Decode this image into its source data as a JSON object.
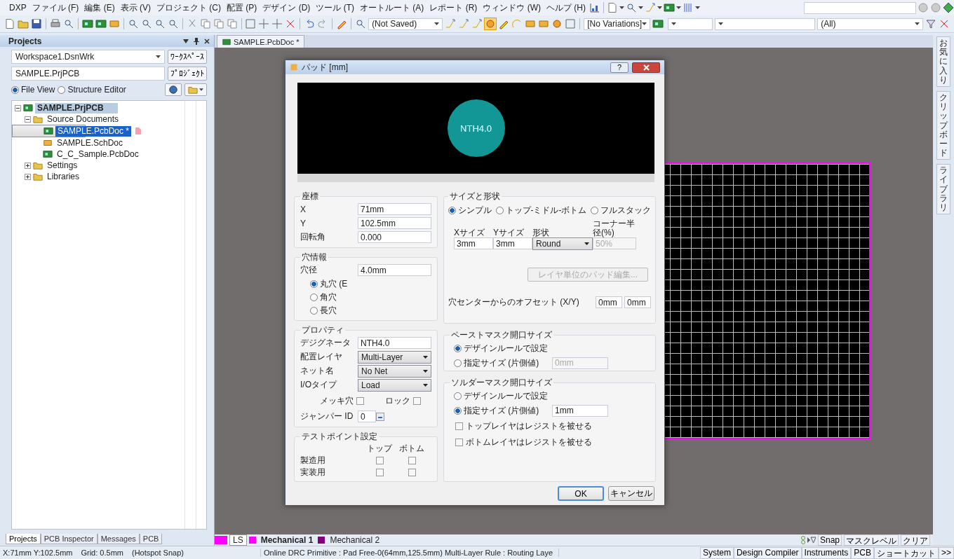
{
  "menu_bar": {
    "items": [
      "DXP",
      "ファイル (F)",
      "編集 (E)",
      "表示 (V)",
      "プロジェクト (C)",
      "配置 (P)",
      "デザイン (D)",
      "ツール (T)",
      "オートルート (A)",
      "レポート (R)",
      "ウィンドウ (W)",
      "ヘルプ (H)"
    ]
  },
  "toolbar": {
    "document_combo": "(Not Saved)",
    "variations_combo": "[No Variations]",
    "filter_combo": "(All)"
  },
  "projects_panel": {
    "title": "Projects",
    "workspace": "Workspace1.DsnWrk",
    "workspace_button": "ﾜｰｸｽﾍﾟｰｽ",
    "project": "SAMPLE.PrjPCB",
    "project_button": "ﾌﾟﾛｼﾞｪｸﾄ",
    "view_options": [
      {
        "label": "File View",
        "selected": true
      },
      {
        "label": "Structure Editor",
        "selected": false
      }
    ],
    "tree": [
      {
        "label": "SAMPLE.PrjPCB",
        "kind": "project",
        "selected": false,
        "expanded": true,
        "children": [
          {
            "label": "Source Documents",
            "kind": "folder",
            "selected": false,
            "expanded": true,
            "children": [
              {
                "label": "SAMPLE.PcbDoc *",
                "kind": "pcb",
                "selected": true,
                "modified": true
              },
              {
                "label": "SAMPLE.SchDoc",
                "kind": "sch",
                "selected": false,
                "modified": false
              },
              {
                "label": "C_C_Sample.PcbDoc",
                "kind": "pcb",
                "selected": false,
                "modified": false
              }
            ]
          },
          {
            "label": "Settings",
            "kind": "folder",
            "selected": false,
            "expanded": false
          },
          {
            "label": "Libraries",
            "kind": "folder",
            "selected": false,
            "expanded": false
          }
        ]
      }
    ]
  },
  "panel_tabs": [
    {
      "label": "Projects",
      "selected": true
    },
    {
      "label": "PCB Inspector",
      "selected": false
    },
    {
      "label": "Messages",
      "selected": false
    },
    {
      "label": "PCB",
      "selected": false
    }
  ],
  "document_tab": {
    "label": "SAMPLE.PcbDoc *"
  },
  "dialog": {
    "title": "パッド [mm]",
    "help": "?",
    "preview_label": "NTH4.0",
    "coordinates": {
      "title": "座標",
      "fields": [
        {
          "kind": "text",
          "label": "X",
          "value": "71mm"
        },
        {
          "kind": "text",
          "label": "Y",
          "value": "102.5mm"
        },
        {
          "kind": "text",
          "label": "回転角",
          "value": "0.000"
        }
      ]
    },
    "hole": {
      "title": "穴情報",
      "fields": [
        {
          "kind": "text",
          "label": "穴径",
          "value": "4.0mm"
        }
      ],
      "shapes": [
        {
          "label": "丸穴 (E",
          "selected": true
        },
        {
          "label": "角穴",
          "selected": false
        },
        {
          "label": "長穴",
          "selected": false
        }
      ]
    },
    "properties": {
      "title": "プロパティ",
      "fields": [
        {
          "kind": "text",
          "label": "デジグネータ",
          "value": "NTH4.0"
        },
        {
          "kind": "select",
          "label": "配置レイヤ",
          "value": "Multi-Layer"
        },
        {
          "kind": "select",
          "label": "ネット名",
          "value": "No Net"
        },
        {
          "kind": "select",
          "label": "I/Oタイプ",
          "value": "Load"
        },
        {
          "kind": "checks",
          "items": [
            {
              "label": "メッキ穴",
              "checked": false
            },
            {
              "label": "ロック",
              "checked": false
            }
          ]
        },
        {
          "kind": "spin",
          "label": "ジャンパー ID",
          "value": "0"
        }
      ]
    },
    "test_points": {
      "title": "テストポイント設定",
      "columns": [
        "トップ",
        "ボトム"
      ],
      "rows": [
        {
          "label": "製造用",
          "checked": [
            false,
            false
          ]
        },
        {
          "label": "実装用",
          "checked": [
            false,
            false
          ]
        }
      ]
    },
    "size_shape": {
      "title": "サイズと形状",
      "modes": [
        {
          "label": "シンプル",
          "selected": true
        },
        {
          "label": "トップ-ミドル-ボトム",
          "selected": false
        },
        {
          "label": "フルスタック",
          "selected": false
        }
      ],
      "cells": [
        {
          "kind": "text",
          "header": "Xサイズ",
          "value": "3mm",
          "disabled": false
        },
        {
          "kind": "text",
          "header": "Yサイズ",
          "value": "3mm",
          "disabled": false
        },
        {
          "kind": "select",
          "header": "形状",
          "value": "Round",
          "disabled": false
        },
        {
          "kind": "text",
          "header": "コーナー半径(%)",
          "value": "50%",
          "disabled": true
        }
      ],
      "layer_button": {
        "label": "レイヤ単位のパッド編集...",
        "disabled": true
      },
      "offset_label": "穴センターからのオフセット (X/Y)",
      "offsets": [
        "0mm",
        "0mm"
      ]
    },
    "paste_mask": {
      "title": "ペーストマスク開口サイズ",
      "options": [
        {
          "label": "デザインルールで設定",
          "selected": true
        },
        {
          "label": "指定サイズ (片側値)",
          "selected": false,
          "value": "0mm"
        }
      ]
    },
    "solder_mask": {
      "title": "ソルダーマスク開口サイズ",
      "options": [
        {
          "label": "デザインルールで設定",
          "selected": false
        },
        {
          "label": "指定サイズ (片側値)",
          "selected": true,
          "value": "1mm"
        }
      ],
      "checks": [
        {
          "label": "トップレイヤはレジストを被せる",
          "checked": false
        },
        {
          "label": "ボトムレイヤはレジストを被せる",
          "checked": false
        }
      ]
    },
    "buttons": [
      "OK",
      "キャンセル"
    ]
  },
  "layer_bar": {
    "layers": [
      {
        "label": "LS",
        "color": "#ff00ff",
        "selected": false
      },
      {
        "label": "Mechanical 1",
        "color": "#ff00ff",
        "selected": true
      },
      {
        "label": "Mechanical 2",
        "color": "#800080",
        "selected": false
      }
    ],
    "buttons": [
      "Snap",
      "マスクレベル",
      "クリア"
    ]
  },
  "right_strip": [
    "お気に入り",
    "クリップボード",
    "ライブラリ"
  ],
  "status_bar": {
    "position": "X:71mm Y:102.5mm",
    "grid": "Grid: 0.5mm",
    "snap": "(Hotspot Snap)",
    "message": "Online DRC Primitive : Pad Free-0(64mm,125.5mm)  Multi-Layer Rule : Routing Laye",
    "buttons": [
      "System",
      "Design Compiler",
      "Instruments",
      "PCB",
      "ショートカット",
      ">>"
    ]
  }
}
